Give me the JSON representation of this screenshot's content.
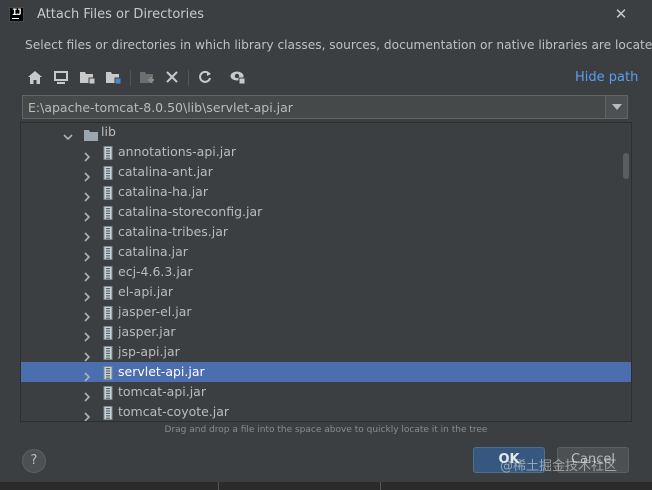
{
  "window": {
    "title": "Attach Files or Directories",
    "close_symbol": "✕"
  },
  "description": "Select files or directories in which library classes, sources, documentation or native libraries are located",
  "toolbar": {
    "icons": [
      "home-icon",
      "desktop-icon",
      "project-folder-icon",
      "module-folder-icon",
      "new-folder-icon",
      "delete-icon",
      "refresh-icon",
      "show-hidden-icon"
    ],
    "hide_path_label": "Hide path"
  },
  "path_field": {
    "value": "E:\\apache-tomcat-8.0.50\\lib\\servlet-api.jar"
  },
  "tree": {
    "folder": {
      "label": "lib",
      "expanded": true
    },
    "items": [
      {
        "label": "annotations-api.jar",
        "selected": false
      },
      {
        "label": "catalina-ant.jar",
        "selected": false
      },
      {
        "label": "catalina-ha.jar",
        "selected": false
      },
      {
        "label": "catalina-storeconfig.jar",
        "selected": false
      },
      {
        "label": "catalina-tribes.jar",
        "selected": false
      },
      {
        "label": "catalina.jar",
        "selected": false
      },
      {
        "label": "ecj-4.6.3.jar",
        "selected": false
      },
      {
        "label": "el-api.jar",
        "selected": false
      },
      {
        "label": "jasper-el.jar",
        "selected": false
      },
      {
        "label": "jasper.jar",
        "selected": false
      },
      {
        "label": "jsp-api.jar",
        "selected": false
      },
      {
        "label": "servlet-api.jar",
        "selected": true
      },
      {
        "label": "tomcat-api.jar",
        "selected": false
      },
      {
        "label": "tomcat-coyote.jar",
        "selected": false
      }
    ]
  },
  "hint": "Drag and drop a file into the space above to quickly locate it in the tree",
  "footer": {
    "help_label": "?",
    "ok_label": "OK",
    "cancel_label": "Cancel"
  },
  "watermark": "@稀土掘金技术社区",
  "colors": {
    "background": "#3c3f41",
    "selection": "#4b6eaf",
    "link": "#589df6",
    "primary_button": "#365880"
  }
}
